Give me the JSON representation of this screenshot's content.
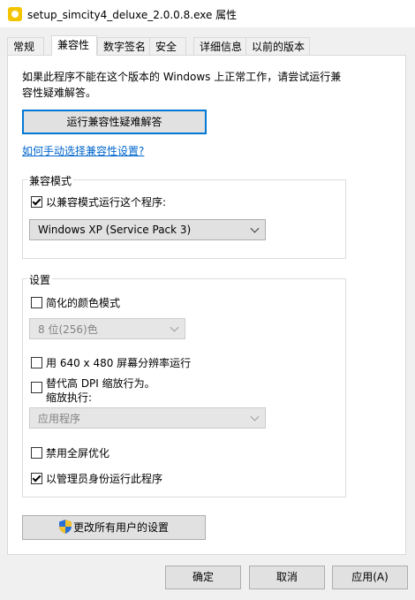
{
  "window": {
    "title": "setup_simcity4_deluxe_2.0.0.8.exe 属性"
  },
  "tabs": [
    {
      "label": "常规",
      "active": false
    },
    {
      "label": "兼容性",
      "active": true
    },
    {
      "label": "数字签名",
      "active": false
    },
    {
      "label": "安全",
      "active": false
    },
    {
      "label": "详细信息",
      "active": false
    },
    {
      "label": "以前的版本",
      "active": false
    }
  ],
  "intro": {
    "line1": "如果此程序不能在这个版本的 Windows 上正常工作，请尝试运行兼",
    "line2": "容性疑难解答。"
  },
  "troubleshoot_button": "运行兼容性疑难解答",
  "manual_link": "如何手动选择兼容性设置?",
  "compat_mode": {
    "legend": "兼容模式",
    "checkbox_label": "以兼容模式运行这个程序:",
    "checked": true,
    "selected_os": "Windows XP (Service Pack 3)"
  },
  "settings": {
    "legend": "设置",
    "reduced_color_label": "简化的颜色模式",
    "reduced_color_checked": false,
    "color_select": "8 位(256)色",
    "res_640_label": "用 640 x 480 屏幕分辨率运行",
    "res_640_checked": false,
    "dpi_label_line1": "替代高 DPI 缩放行为。",
    "dpi_label_line2": "缩放执行:",
    "dpi_checked": false,
    "dpi_select": "应用程序",
    "fullscreen_label": "禁用全屏优化",
    "fullscreen_checked": false,
    "admin_label": "以管理员身份运行此程序",
    "admin_checked": true
  },
  "all_users_button": "更改所有用户的设置",
  "footer": {
    "ok": "确定",
    "cancel": "取消",
    "apply": "应用(A)"
  }
}
